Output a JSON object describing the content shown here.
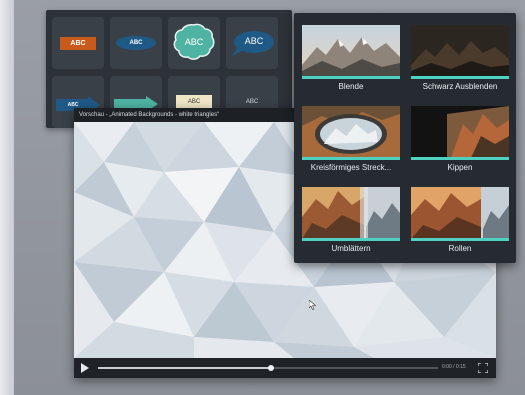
{
  "callouts": {
    "items": [
      {
        "id": "orange-rect",
        "text": "ABC",
        "color": "#c85a1b"
      },
      {
        "id": "blue-oval",
        "text": "ABC",
        "color": "#1f5a86"
      },
      {
        "id": "teal-cloud",
        "text": "ABC",
        "color": "#4fb3a3"
      },
      {
        "id": "blue-speech",
        "text": "ABC",
        "color": "#1f5a86"
      },
      {
        "id": "blue-arrow",
        "text": "ABC",
        "color": "#1f5a86"
      },
      {
        "id": "teal-arrow",
        "text": "",
        "color": "#4fb3a3"
      },
      {
        "id": "cream-note",
        "text": "ABC",
        "color": "#efe6c6"
      },
      {
        "id": "plain-text",
        "text": "ABC",
        "color": "#ffffff"
      }
    ]
  },
  "preview": {
    "title": "Vorschau - „Animated Backgrounds - white triangles“",
    "time": "0:00 / 0:15",
    "progress": 0.51
  },
  "transitions": {
    "items": [
      {
        "label": "Blende",
        "style": "mountains"
      },
      {
        "label": "Schwarz Ausblenden",
        "style": "dark-mountains"
      },
      {
        "label": "Kreisförmiges Streck...",
        "style": "circle"
      },
      {
        "label": "Kippen",
        "style": "flip"
      },
      {
        "label": "Umblättern",
        "style": "pageturn"
      },
      {
        "label": "Rollen",
        "style": "roll"
      }
    ]
  },
  "colors": {
    "accent": "#4fd1c2",
    "panel": "#262b31"
  }
}
